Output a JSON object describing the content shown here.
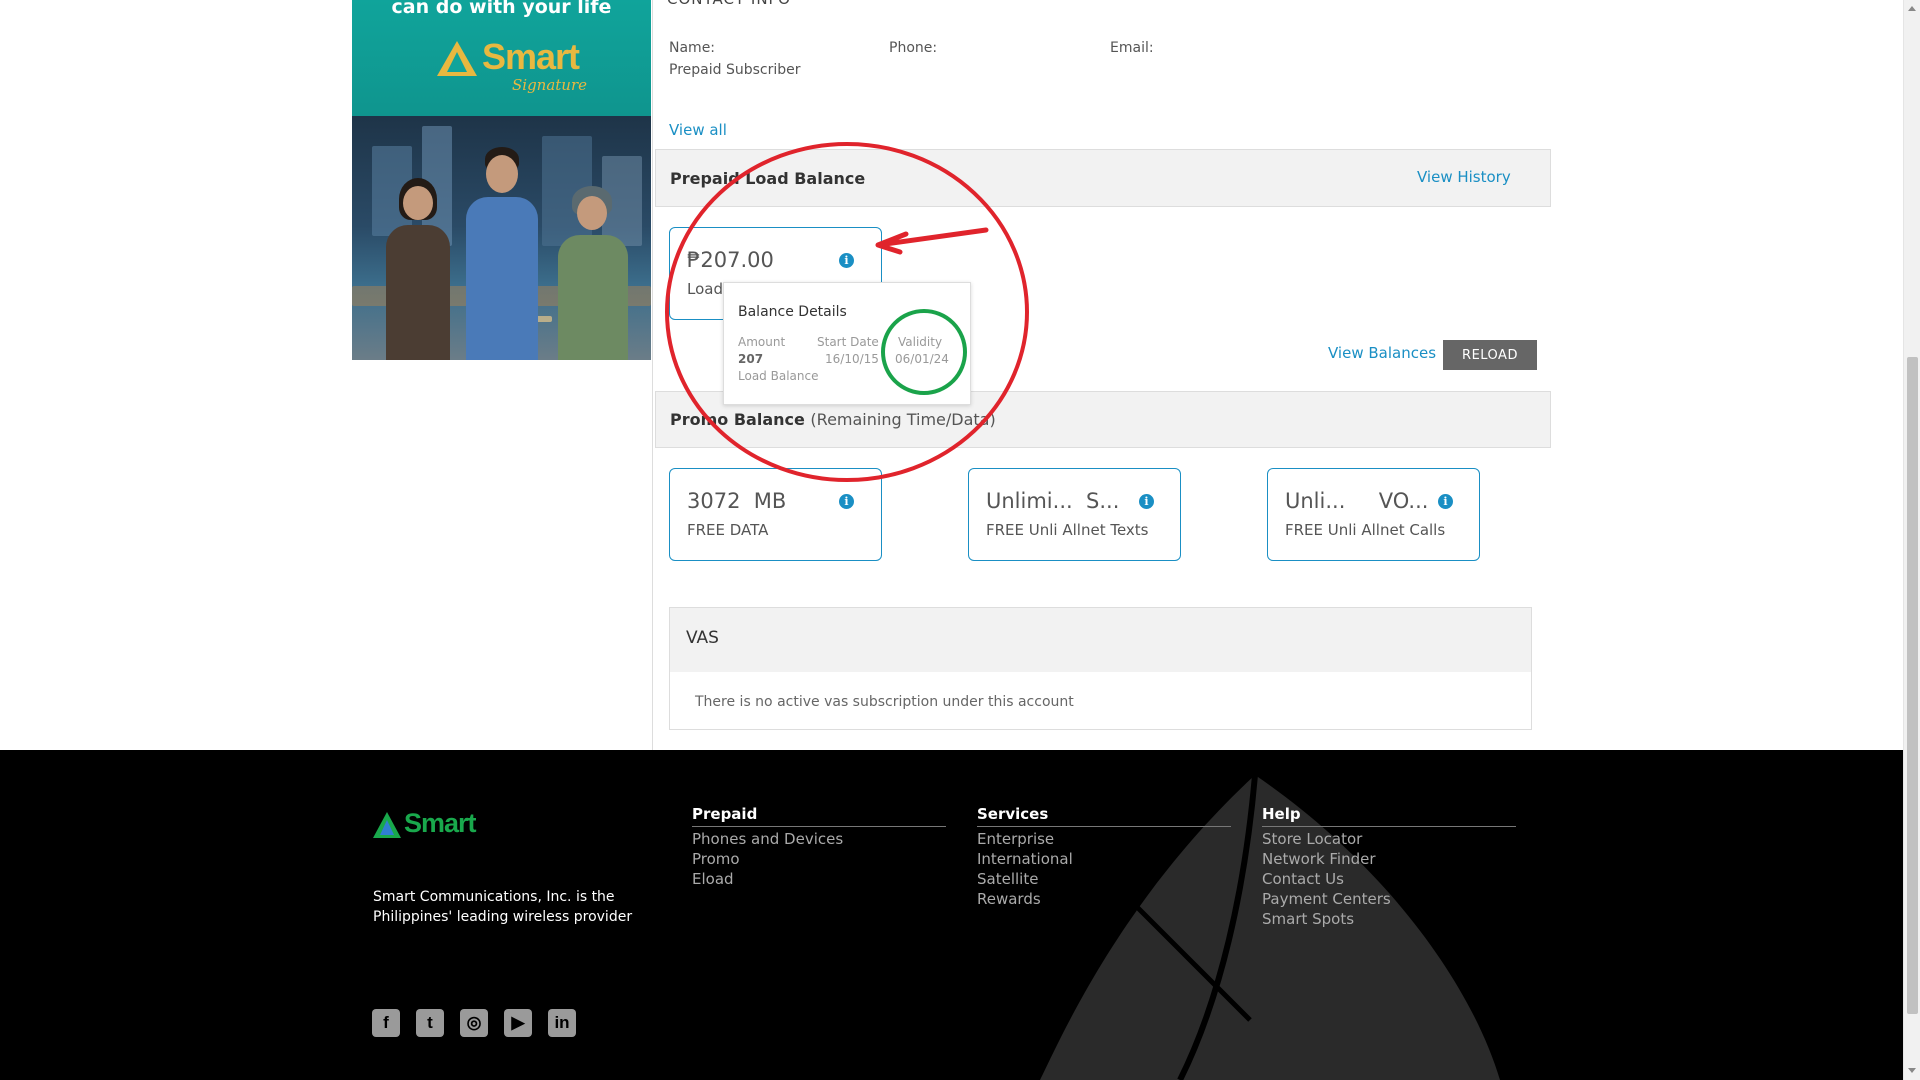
{
  "banner": {
    "tagline": "can do with your life",
    "logo_text": "Smart",
    "logo_sub": "Signature"
  },
  "contact": {
    "heading": "CONTACT INFO",
    "name_label": "Name:",
    "name_value": "Prepaid Subscriber",
    "phone_label": "Phone:",
    "email_label": "Email:",
    "view_all": "View all"
  },
  "prepaid": {
    "title": "Prepaid Load Balance",
    "view_history": "View History",
    "balance_value": "₱207.00",
    "balance_label": "Load Balance",
    "view_balances": "View Balances",
    "reload": "RELOAD"
  },
  "tooltip": {
    "title": "Balance Details",
    "amount_header": "Amount",
    "start_header": "Start Date",
    "validity_header": "Validity",
    "amount": "207",
    "start_date": "16/10/15",
    "validity": "06/01/24",
    "note": "Load Balance"
  },
  "promo": {
    "title": "Promo Balance",
    "subtitle": "(Remaining Time/Data)",
    "cards": [
      {
        "value": "3072  MB",
        "label": "FREE DATA"
      },
      {
        "value": "Unlimi...  S...",
        "label": "FREE Unli Allnet Texts"
      },
      {
        "value": "Unli...     VO...",
        "label": "FREE Unli Allnet Calls"
      }
    ]
  },
  "vas": {
    "title": "VAS",
    "message": "There is no active vas subscription under this account"
  },
  "footer": {
    "logo_text": "Smart",
    "about": "Smart Communications, Inc. is the Philippines' leading wireless provider",
    "columns": [
      {
        "title": "Prepaid",
        "links": [
          "Phones and Devices",
          "Promo",
          "Eload"
        ]
      },
      {
        "title": "Services",
        "links": [
          "Enterprise",
          "International",
          "Satellite",
          "Rewards"
        ]
      },
      {
        "title": "Help",
        "links": [
          "Store Locator",
          "Network Finder",
          "Contact Us",
          "Payment Centers",
          "Smart Spots"
        ]
      }
    ],
    "social": [
      {
        "icon": "facebook-icon",
        "glyph": "f"
      },
      {
        "icon": "twitter-icon",
        "glyph": "t"
      },
      {
        "icon": "instagram-icon",
        "glyph": "◎"
      },
      {
        "icon": "youtube-icon",
        "glyph": "▶"
      },
      {
        "icon": "linkedin-icon",
        "glyph": "in"
      }
    ]
  },
  "colors": {
    "link": "#1a8fc4",
    "annotation_red": "#e0242c",
    "annotation_green": "#1aa34a",
    "brand_green": "#19a84c",
    "brand_gold": "#e8b840"
  }
}
